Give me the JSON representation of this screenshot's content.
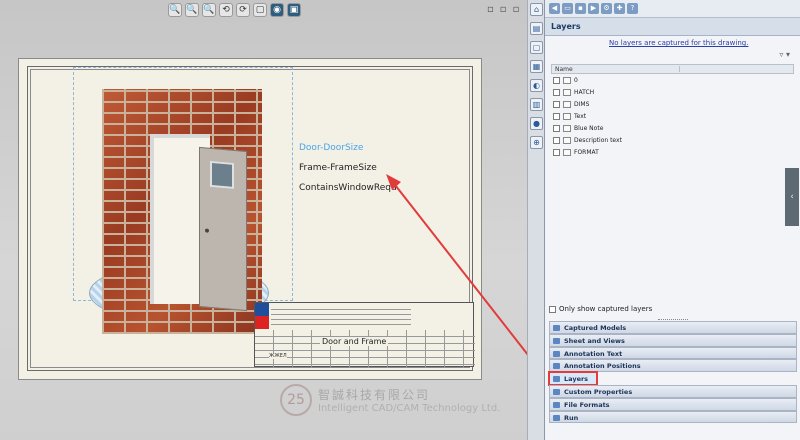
{
  "toolbar": {
    "view_tools": [
      "🔍",
      "🔍",
      "🔍",
      "⟲",
      "⟳",
      "▢",
      "◉",
      "▣"
    ],
    "win_controls": [
      "▫",
      "▫",
      "▫"
    ]
  },
  "drawing": {
    "labels": [
      "Door-DoorSize",
      "Frame-FrameSize",
      "ContainsWindowReqd"
    ],
    "title_block_name": "Door and Frame",
    "title_block_small": "ЖЖЕЛ"
  },
  "watermark": {
    "logo_text": "25",
    "chinese": "智誠科技有限公司",
    "english": "Intelligent CAD/CAM Technology Ltd."
  },
  "task_strip": {
    "icons": [
      "⌂",
      "▤",
      "▢",
      "▦",
      "◐",
      "▥",
      "●",
      "⊕"
    ]
  },
  "panel": {
    "title": "Layers",
    "notice": "No layers are captured for this drawing.",
    "filter_icon": "▿ ▾",
    "columns": [
      "Name",
      ""
    ],
    "layers": [
      "0",
      "HATCH",
      "DIMS",
      "Text",
      "Blue Note",
      "Description text",
      "FORMAT"
    ],
    "only_captured_label": "Only show captured layers",
    "sections": [
      "Captured Models",
      "Sheet and Views",
      "Annotation Text",
      "Annotation Positions",
      "Layers",
      "Custom Properties",
      "File Formats",
      "Run"
    ],
    "highlighted_section": "Layers",
    "grip_icon": "‹"
  },
  "colors": {
    "accent_blue": "#4aa3e6",
    "highlight_red": "#e23b3b",
    "panel_title": "#1d3b66"
  }
}
